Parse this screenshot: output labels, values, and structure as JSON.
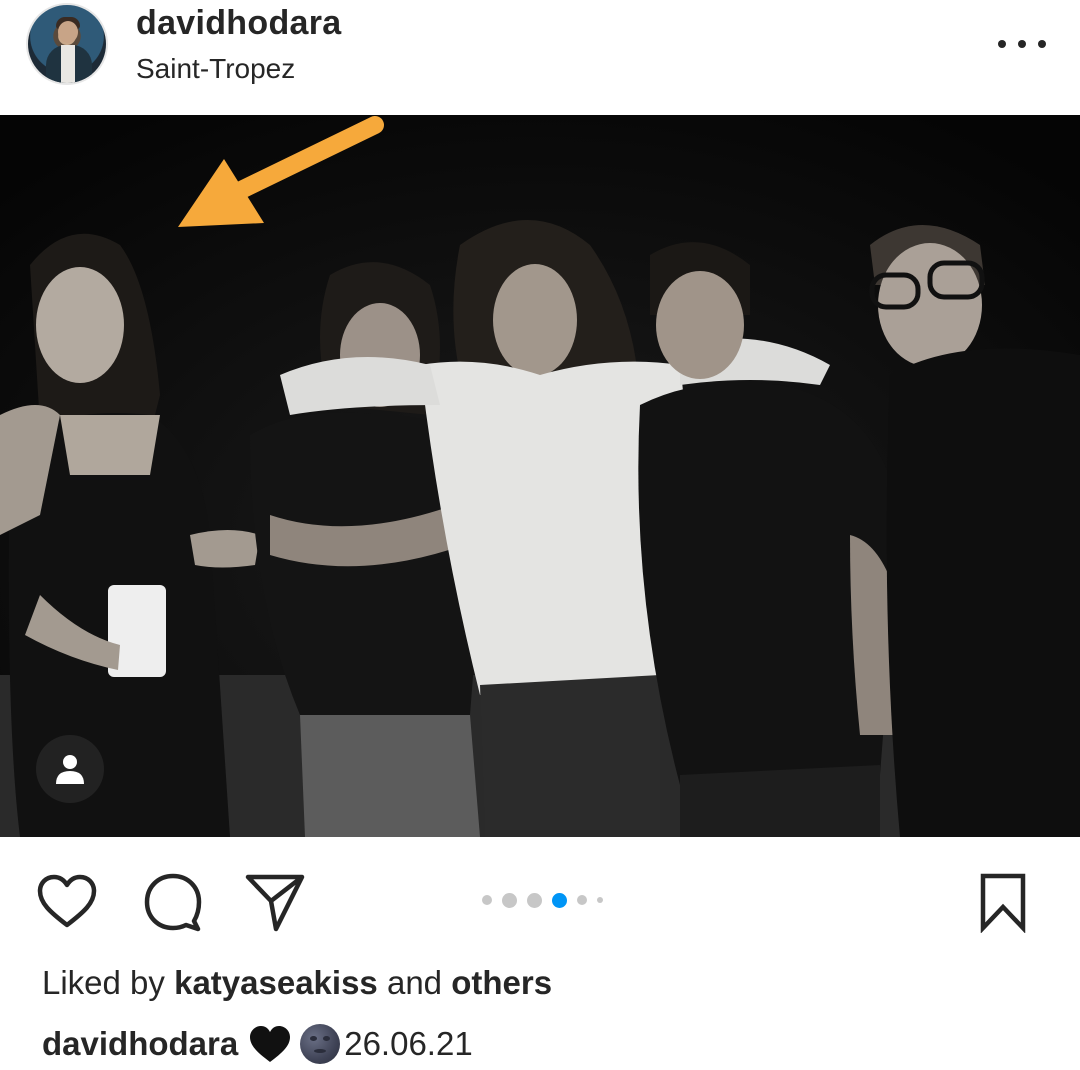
{
  "header": {
    "username": "davidhodara",
    "location": "Saint-Tropez",
    "more_icon": "more-horizontal-icon"
  },
  "post": {
    "carousel": {
      "total": 6,
      "current": 4
    },
    "tag_icon": "person-icon"
  },
  "actions": {
    "like_icon": "heart-icon",
    "comment_icon": "comment-icon",
    "share_icon": "send-icon",
    "save_icon": "bookmark-icon"
  },
  "likes": {
    "prefix": "Liked by",
    "user": "katyaseakiss",
    "conjunction": "and",
    "others": "others"
  },
  "caption": {
    "username": "davidhodara",
    "emojis": [
      "black-heart",
      "new-moon-face"
    ],
    "text": "26.06.21"
  },
  "colors": {
    "text": "#262626",
    "accent_blue": "#0095f6",
    "arrow_orange": "#f6a93b"
  }
}
